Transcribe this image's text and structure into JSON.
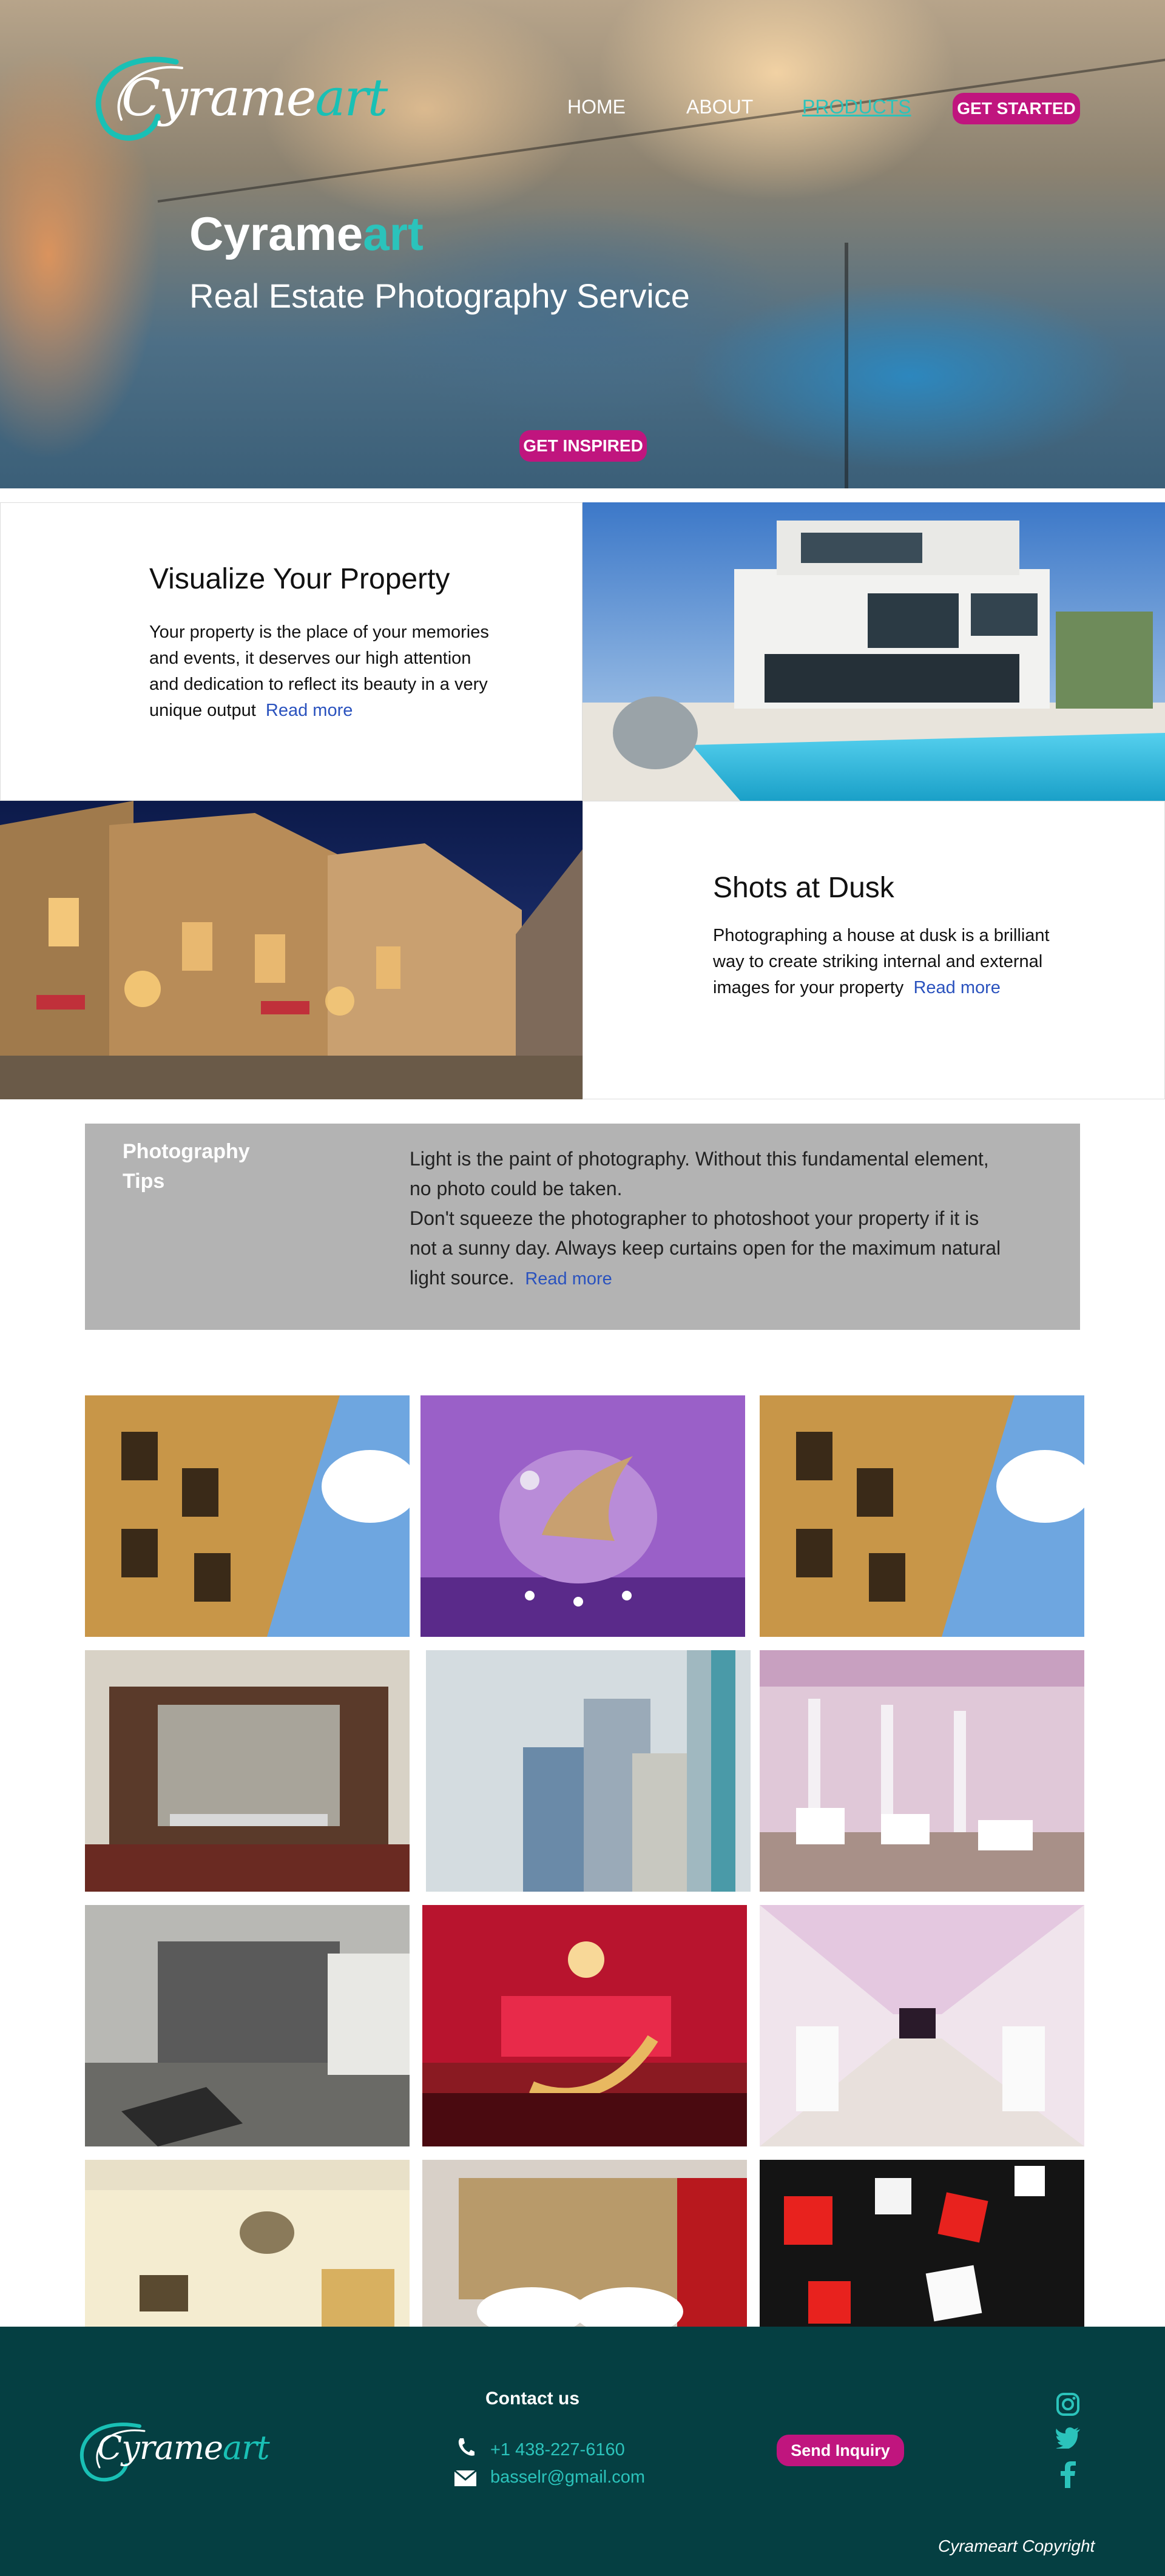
{
  "brand": {
    "name_main": "Cyrame",
    "name_accent": "art"
  },
  "nav": {
    "home": "HOME",
    "about": "ABOUT",
    "products": "PRODUCTS",
    "get_started": "GET STARTED"
  },
  "hero": {
    "title_main": "Cyrame",
    "title_accent": "art",
    "subtitle": "Real Estate Photography Service",
    "cta": "GET INSPIRED"
  },
  "features": [
    {
      "heading": "Visualize Your Property",
      "body": "Your property is the place of your memories and events, it deserves our high attention and dedication to reflect its beauty in a very unique output",
      "read_more": "Read more"
    },
    {
      "heading": "Shots at Dusk",
      "body": "Photographing a house at dusk is a brilliant way to create striking internal and external images for your property",
      "read_more": "Read more"
    }
  ],
  "tips": {
    "label": "Photography Tips",
    "line1": "Light is the paint of photography. Without this fundamental element, no photo could be taken.",
    "line2": "Don't squeeze the photographer to photoshoot your property if it is not a sunny day. Always keep curtains open for the maximum natural light source.",
    "read_more": "Read more"
  },
  "footer": {
    "contact_title": "Contact us",
    "phone": "+1 438-227-6160",
    "email": "basselr@gmail.com",
    "inquiry": "Send Inquiry",
    "copyright": "Cyrameart Copyright",
    "social": [
      "instagram-icon",
      "twitter-icon",
      "facebook-icon"
    ]
  },
  "colors": {
    "accent": "#2bc3bb",
    "pink": "#c0157e",
    "footer_bg": "#053f42",
    "tips_bg": "#b3b3b3",
    "link": "#2a52be"
  }
}
